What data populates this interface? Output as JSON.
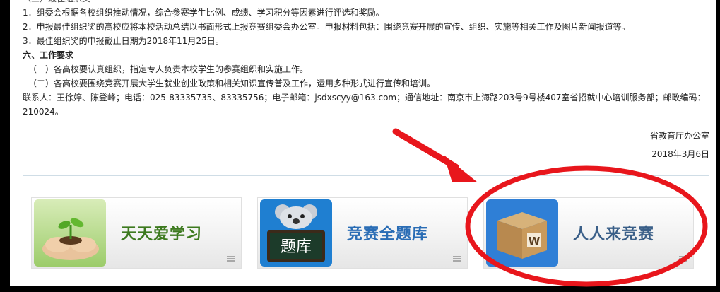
{
  "article": {
    "cut_line": "（三）最佳组织奖",
    "items": [
      "1．组委会根据各校组织推动情况，综合参赛学生比例、成绩、学习积分等因素进行评选和奖励。",
      "2．申报最佳组织奖的高校应将本校活动总结以书面形式上报竞赛组委会办公室。申报材料包括：围绕竞赛开展的宣传、组织、实施等相关工作及图片新闻报道等。",
      "3．最佳组织奖的申报截止日期为2018年11月25日。"
    ],
    "section_heading": "六、工作要求",
    "requirements": [
      "（一）各高校要认真组织，指定专人负责本校学生的参赛组织和实施工作。",
      "（二）各高校要围绕竞赛开展大学生就业创业政策和相关知识宣传普及工作，运用多种形式进行宣传和培训。"
    ],
    "contact_line1": "联系人：王徐婷、陈登峰；电话：025-83335735、83335756；电子邮箱：jsdxscyy@163.com；通信地址：南京市上海路203号9号楼407室省招就中心培训服务部；邮政编码：",
    "contact_line2": "210024。",
    "signature": "省教育厅办公室",
    "date": "2018年3月6日"
  },
  "tiles": [
    {
      "title": "天天爱学习",
      "title_color": "#3d7a1f",
      "icon": "seedling-in-hands-image"
    },
    {
      "title": "竞赛全题库",
      "title_color": "#2a6db5",
      "icon": "koala-question-bank-icon",
      "icon_text": "题库"
    },
    {
      "title": "人人来竞赛",
      "title_color": "#3a5f88",
      "icon": "cardboard-box-icon",
      "icon_text": "W"
    }
  ],
  "annotation": {
    "color": "#e8161c",
    "shapes": [
      "arrow",
      "circle"
    ]
  }
}
